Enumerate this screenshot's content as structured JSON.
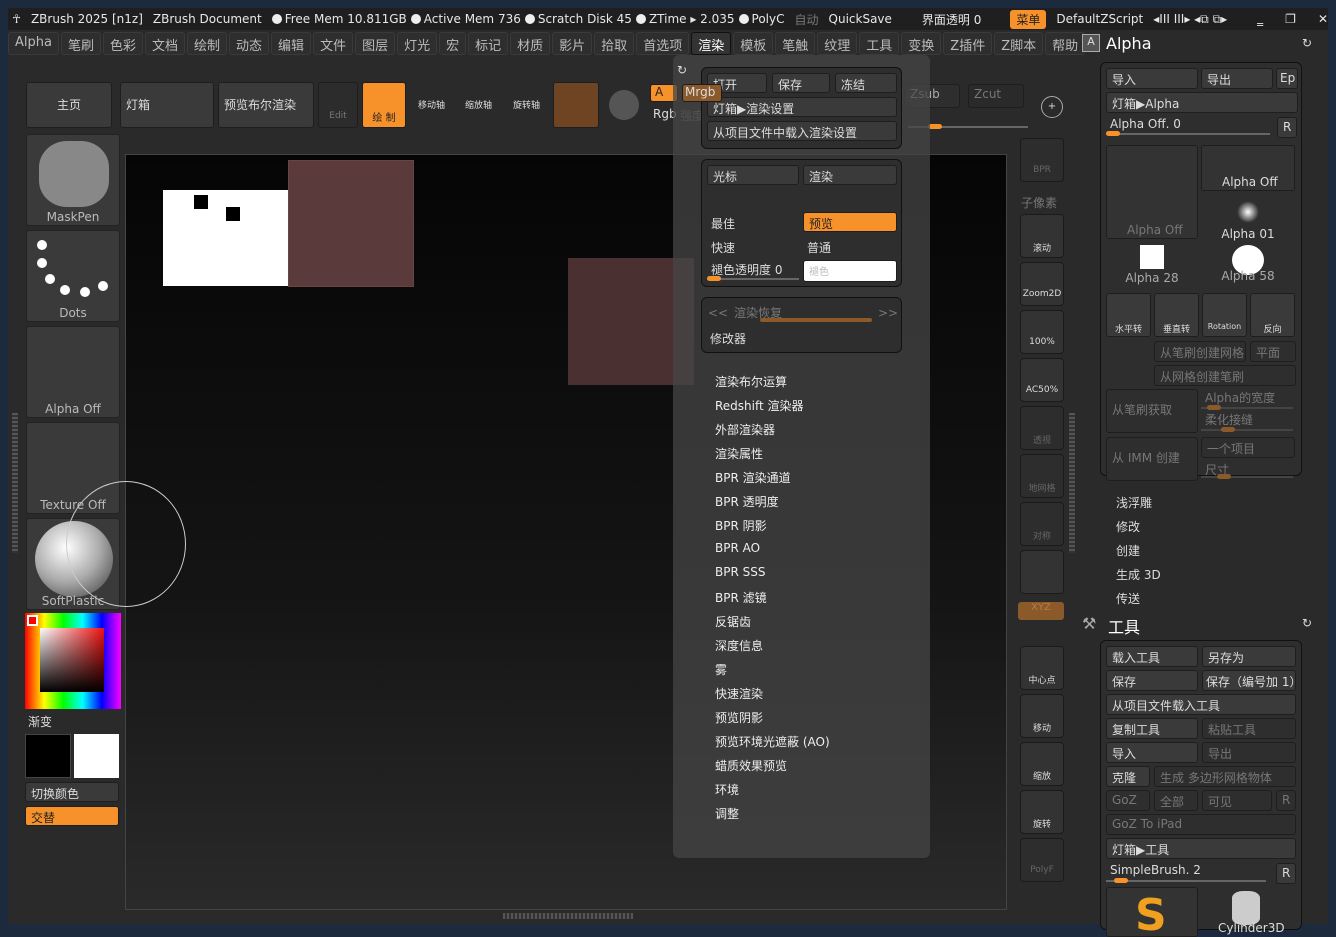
{
  "titlebar": {
    "app": "ZBrush 2025 [n1z]",
    "doc": "ZBrush Document",
    "free_mem": "Free Mem 10.811GB",
    "active_mem": "Active Mem 736",
    "scratch": "Scratch Disk 45",
    "ztime": "ZTime ▸ 2.035",
    "polyc": "PolyC",
    "auto": "自动",
    "quicksave": "QuickSave",
    "transparency": "界面透明 0",
    "menu": "菜单",
    "script": "DefaultZScript"
  },
  "menu": [
    "Alpha",
    "笔刷",
    "色彩",
    "文档",
    "绘制",
    "动态",
    "编辑",
    "文件",
    "图层",
    "灯光",
    "宏",
    "标记",
    "材质",
    "影片",
    "拾取",
    "首选项",
    "渲染",
    "模板",
    "笔触",
    "纹理",
    "工具",
    "变换",
    "Z插件",
    "Z脚本",
    "帮助"
  ],
  "toolbar": {
    "home": "主页",
    "lightbox": "灯箱",
    "bpr_preview": "预览布尔渲染",
    "edit": "Edit",
    "draw": "绘 制",
    "move": "移动轴",
    "scale": "缩放轴",
    "rotate": "旋转轴",
    "a": "A",
    "mrgb": "Mrgb",
    "rgb": "Rgb",
    "intensity": "强度",
    "zsub": "Zsub",
    "zcut": "Zcut"
  },
  "shelf": {
    "brush": "MaskPen",
    "stroke": "Dots",
    "alpha": "Alpha Off",
    "texture": "Texture Off",
    "material": "SoftPlastic",
    "gradient": "渐变",
    "switch_color": "切换颜色",
    "alternate": "交替"
  },
  "render_menu": {
    "open": "打开",
    "save": "保存",
    "freeze": "冻结",
    "lightbox": "灯箱▶渲染设置",
    "load": "从项目文件中载入渲染设置",
    "cursor": "光标",
    "render": "渲染",
    "best": "最佳",
    "preview": "预览",
    "fast": "快速",
    "normal": "普通",
    "fade": "褪色透明度 0",
    "fade_color": "褪色",
    "restore": "渲染恢复",
    "modifiers": "修改器",
    "items": [
      "渲染布尔运算",
      "Redshift 渲染器",
      "外部渲染器",
      "渲染属性",
      "BPR 渲染通道",
      "BPR 透明度",
      "BPR 阴影",
      "BPR AO",
      "BPR SSS",
      "BPR 滤镜",
      "反锯齿",
      "深度信息",
      "雾",
      "快速渲染",
      "预览阴影",
      "预览环境光遮蔽 (AO)",
      "蜡质效果预览",
      "环境",
      "调整"
    ]
  },
  "tray": [
    "BPR",
    "子像素",
    "滚动",
    "Zoom2D",
    "100%",
    "AC50%",
    "透视",
    "地网格",
    "对称",
    "",
    "XYZ",
    "中心点",
    "移动",
    "缩放",
    "旋转",
    "PolyF"
  ],
  "alpha_panel": {
    "title": "Alpha",
    "import": "导入",
    "export": "导出",
    "ep": "Ep",
    "lightbox": "灯箱▶Alpha",
    "alpha_off": "Alpha Off. 0",
    "r": "R",
    "thumbs": [
      "Alpha Off",
      "Alpha Off",
      "Alpha 01",
      "Alpha 28",
      "Alpha 58"
    ],
    "flip_h": "水平转",
    "flip_v": "垂直转",
    "rotation": "Rotation",
    "invert": "反向",
    "mesh_from_brush": "从笔刷创建网格",
    "plane": "平面",
    "brush_from_mesh": "从网格创建笔刷",
    "from_brush": "从笔刷获取",
    "alpha_width": "Alpha的宽度",
    "soften": "柔化接缝",
    "from_imm": "从 IMM 创建",
    "one_item": "一个项目",
    "size": "尺寸",
    "sub": [
      "浅浮雕",
      "修改",
      "创建",
      "生成 3D",
      "传送"
    ]
  },
  "tool_panel": {
    "title": "工具",
    "load": "载入工具",
    "save_as": "另存为",
    "save": "保存",
    "save_inc": "保存（编号加 1）",
    "load_project": "从项目文件载入工具",
    "copy": "复制工具",
    "paste": "粘贴工具",
    "import": "导入",
    "export": "导出",
    "clone": "克隆",
    "make_polymesh": "生成 多边形网格物体",
    "goz": "GoZ",
    "all": "全部",
    "visible": "可见",
    "r": "R",
    "goz_ipad": "GoZ To iPad",
    "lightbox": "灯箱▶工具",
    "current": "SimpleBrush. 2",
    "cylinder": "Cylinder3D"
  },
  "colors": {
    "accent": "#f7922a",
    "panel": "#2e2e2e",
    "canvas": "#0b0b0b"
  }
}
